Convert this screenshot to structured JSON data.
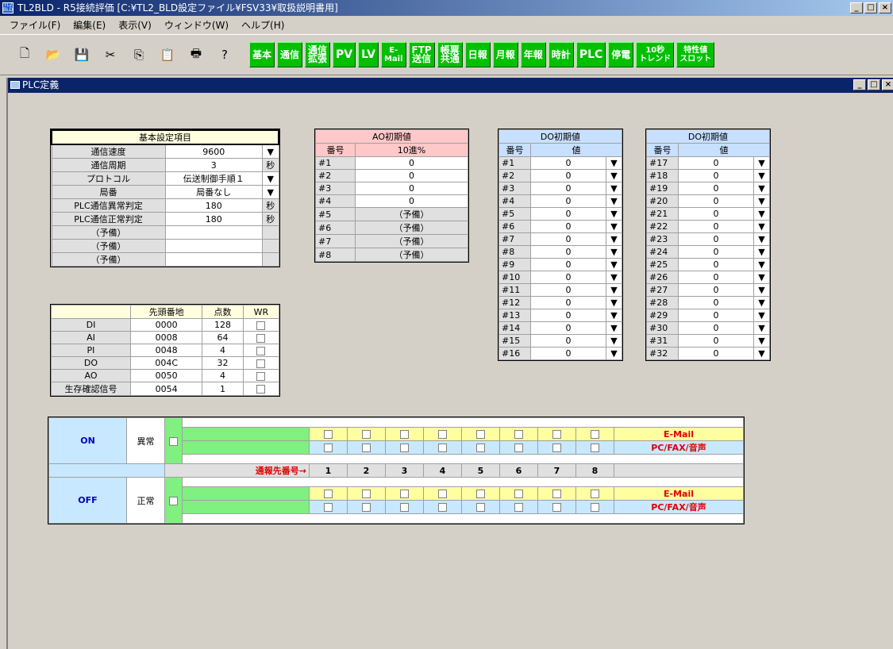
{
  "window": {
    "title": "TL2BLD - R5接続評価 [C:¥TL2_BLD設定ファイル¥FSV33¥取扱説明書用]",
    "icon_text": "TL2 BLD",
    "min": "_",
    "max": "□",
    "close": "×"
  },
  "menu": [
    "ファイル(F)",
    "編集(E)",
    "表示(V)",
    "ウィンドウ(W)",
    "ヘルプ(H)"
  ],
  "toolbar_icons": [
    "new-icon",
    "open-icon",
    "save-icon",
    "cut-icon",
    "copy-icon",
    "paste-icon",
    "print-icon",
    "help-icon"
  ],
  "toolbar_icon_glyphs": [
    "🗋",
    "📂",
    "💾",
    "✂",
    "⎘",
    "📋",
    "🖶",
    "?"
  ],
  "green_buttons": [
    {
      "label": "基本",
      "size": "normal"
    },
    {
      "label": "通信",
      "size": "normal"
    },
    {
      "label": "通信\n拡張",
      "size": "normal"
    },
    {
      "label": "PV",
      "size": "big"
    },
    {
      "label": "LV",
      "size": "big"
    },
    {
      "label": "E-\nMail",
      "size": "small"
    },
    {
      "label": "FTP\n送信",
      "size": "normal"
    },
    {
      "label": "帳票\n共通",
      "size": "normal"
    },
    {
      "label": "日報",
      "size": "normal"
    },
    {
      "label": "月報",
      "size": "normal"
    },
    {
      "label": "年報",
      "size": "normal"
    },
    {
      "label": "時計",
      "size": "normal"
    },
    {
      "label": "PLC",
      "size": "big"
    },
    {
      "label": "停電",
      "size": "normal"
    },
    {
      "label": "10秒\nトレンド",
      "size": "small"
    },
    {
      "label": "特性値\nスロット",
      "size": "small"
    }
  ],
  "mdi": {
    "title": "PLC定義"
  },
  "basic": {
    "header": "基本設定項目",
    "rows": [
      {
        "label": "通信速度",
        "value": "9600",
        "suffix": "▼"
      },
      {
        "label": "通信周期",
        "value": "3",
        "suffix": "秒"
      },
      {
        "label": "プロトコル",
        "value": "伝送制御手順１",
        "suffix": "▼"
      },
      {
        "label": "局番",
        "value": "局番なし",
        "suffix": "▼"
      },
      {
        "label": "PLC通信異常判定",
        "value": "180",
        "suffix": "秒"
      },
      {
        "label": "PLC通信正常判定",
        "value": "180",
        "suffix": "秒"
      },
      {
        "label": "（予備）",
        "value": "",
        "suffix": ""
      },
      {
        "label": "（予備）",
        "value": "",
        "suffix": ""
      },
      {
        "label": "（予備）",
        "value": "",
        "suffix": ""
      }
    ]
  },
  "addr": {
    "headers": [
      "",
      "先頭番地",
      "点数",
      "WR"
    ],
    "rows": [
      {
        "label": "DI",
        "start": "0000",
        "count": "128"
      },
      {
        "label": "AI",
        "start": "0008",
        "count": "64"
      },
      {
        "label": "PI",
        "start": "0048",
        "count": "4"
      },
      {
        "label": "DO",
        "start": "004C",
        "count": "32"
      },
      {
        "label": "AO",
        "start": "0050",
        "count": "4"
      },
      {
        "label": "生存確認信号",
        "start": "0054",
        "count": "1"
      }
    ]
  },
  "ao": {
    "title": "AO初期値",
    "col1": "番号",
    "col2": "10進%",
    "rows": [
      {
        "no": "#1",
        "val": "0"
      },
      {
        "no": "#2",
        "val": "0"
      },
      {
        "no": "#3",
        "val": "0"
      },
      {
        "no": "#4",
        "val": "0"
      },
      {
        "no": "#5",
        "val": "（予備）"
      },
      {
        "no": "#6",
        "val": "（予備）"
      },
      {
        "no": "#7",
        "val": "（予備）"
      },
      {
        "no": "#8",
        "val": "（予備）"
      }
    ]
  },
  "do1": {
    "title": "DO初期値",
    "col1": "番号",
    "col2": "値",
    "rows": [
      {
        "no": "#1",
        "val": "0"
      },
      {
        "no": "#2",
        "val": "0"
      },
      {
        "no": "#3",
        "val": "0"
      },
      {
        "no": "#4",
        "val": "0"
      },
      {
        "no": "#5",
        "val": "0"
      },
      {
        "no": "#6",
        "val": "0"
      },
      {
        "no": "#7",
        "val": "0"
      },
      {
        "no": "#8",
        "val": "0"
      },
      {
        "no": "#9",
        "val": "0"
      },
      {
        "no": "#10",
        "val": "0"
      },
      {
        "no": "#11",
        "val": "0"
      },
      {
        "no": "#12",
        "val": "0"
      },
      {
        "no": "#13",
        "val": "0"
      },
      {
        "no": "#14",
        "val": "0"
      },
      {
        "no": "#15",
        "val": "0"
      },
      {
        "no": "#16",
        "val": "0"
      }
    ]
  },
  "do2": {
    "title": "DO初期値",
    "col1": "番号",
    "col2": "値",
    "rows": [
      {
        "no": "#17",
        "val": "0"
      },
      {
        "no": "#18",
        "val": "0"
      },
      {
        "no": "#19",
        "val": "0"
      },
      {
        "no": "#20",
        "val": "0"
      },
      {
        "no": "#21",
        "val": "0"
      },
      {
        "no": "#22",
        "val": "0"
      },
      {
        "no": "#23",
        "val": "0"
      },
      {
        "no": "#24",
        "val": "0"
      },
      {
        "no": "#25",
        "val": "0"
      },
      {
        "no": "#26",
        "val": "0"
      },
      {
        "no": "#27",
        "val": "0"
      },
      {
        "no": "#28",
        "val": "0"
      },
      {
        "no": "#29",
        "val": "0"
      },
      {
        "no": "#30",
        "val": "0"
      },
      {
        "no": "#31",
        "val": "0"
      },
      {
        "no": "#32",
        "val": "0"
      }
    ]
  },
  "notify": {
    "on": "ON",
    "abnormal": "異常",
    "off": "OFF",
    "normal": "正常",
    "email": "E-Mail",
    "pcfax": "PC/FAX/音声",
    "dest_label": "通報先番号→",
    "numbers": [
      "1",
      "2",
      "3",
      "4",
      "5",
      "6",
      "7",
      "8"
    ]
  },
  "colors": {
    "title_bar": "#0a246a",
    "green_button": "#00c000",
    "pink_header": "#ffc8c8",
    "blue_header": "#c8e0ff",
    "accent_red": "#e00000"
  }
}
